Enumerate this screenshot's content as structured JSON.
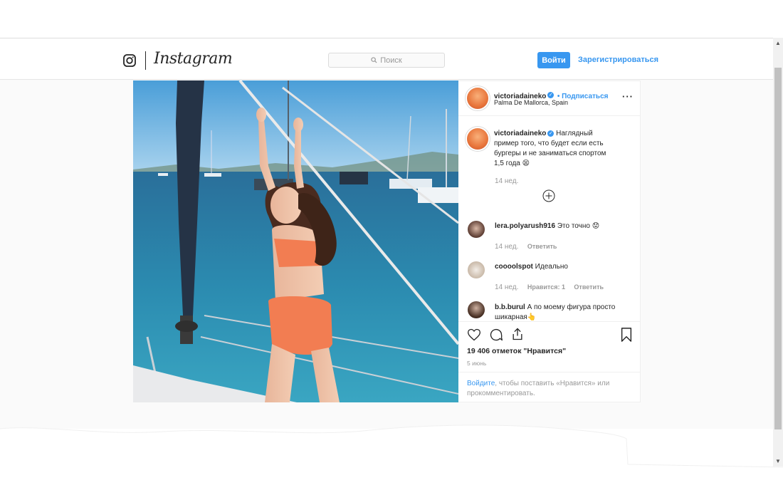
{
  "header": {
    "logo_text": "Instagram",
    "search_placeholder": "Поиск",
    "login_label": "Войти",
    "signup_label": "Зарегистрироваться"
  },
  "post": {
    "username": "victoriadaineko",
    "follow_label": "Подписаться",
    "location": "Palma De Mallorca, Spain",
    "caption_line1": "Наглядный",
    "caption_line2": "пример того, что будет если есть",
    "caption_line3": "бургеры и не заниматься спортом",
    "caption_line4": "1,5 года 😫",
    "caption_time": "14 нед.",
    "likes": "19 406 отметок \"Нравится\"",
    "date": "5 июнь",
    "login_prompt_link": "Войдите",
    "login_prompt_line1_rest": ", чтобы поставить «Нравится» или",
    "login_prompt_line2": "прокомментировать."
  },
  "comments": [
    {
      "username": "lera.polyarush916",
      "text": "Это точно 😟",
      "time": "14 нед.",
      "reply_label": "Ответить"
    },
    {
      "username": "coooolspot",
      "text": "Идеально",
      "time": "14 нед.",
      "likes_label": "Нравится: 1",
      "reply_label": "Ответить"
    },
    {
      "username": "b.b.burul",
      "text_line1": "А по моему фигура просто",
      "text_line2": "шикарная👆"
    }
  ],
  "icons": [
    "instagram-glyph-icon",
    "search-icon",
    "verified-icon",
    "more-icon",
    "load-more-icon",
    "heart-icon",
    "comment-icon",
    "share-icon",
    "bookmark-icon"
  ],
  "colors": {
    "accent": "#3897f0",
    "text": "#262626",
    "muted": "#999999"
  }
}
